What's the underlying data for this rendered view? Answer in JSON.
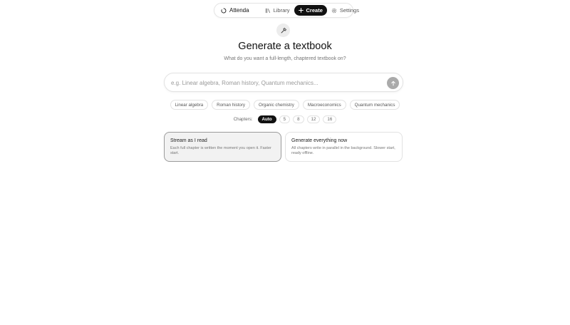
{
  "nav": {
    "brand": "Attenda",
    "library": "Library",
    "create": "Create",
    "settings": "Settings"
  },
  "hero": {
    "icon": "wand-icon",
    "title": "Generate a textbook",
    "subtitle": "What do you want a full-length, chaptered textbook on?"
  },
  "search": {
    "placeholder": "e.g. Linear algebra, Roman history, Quantum mechanics...",
    "value": ""
  },
  "suggestions": [
    "Linear algebra",
    "Roman history",
    "Organic chemistry",
    "Macroeconomics",
    "Quantum mechanics"
  ],
  "chapters": {
    "label": "Chapters:",
    "options": [
      "Auto",
      "5",
      "8",
      "12",
      "16"
    ],
    "selected": "Auto"
  },
  "modes": [
    {
      "title": "Stream as I read",
      "description": "Each full chapter is written the moment you open it. Faster start.",
      "selected": true
    },
    {
      "title": "Generate everything now",
      "description": "All chapters write in parallel in the background. Slower start, ready offline.",
      "selected": false
    }
  ],
  "colors": {
    "accent": "#111111",
    "send_button": "#aaaaaa",
    "border": "#e2e2e2"
  }
}
